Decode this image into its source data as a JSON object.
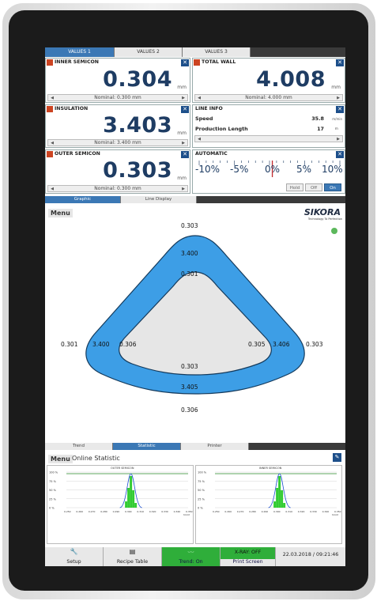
{
  "top_tabs": [
    "VALUES 1",
    "VALUES 2",
    "VALUES 3"
  ],
  "tiles": {
    "inner_semicon": {
      "title": "INNER SEMICON",
      "value": "0.304",
      "unit": "mm",
      "nominal": "Nominal: 0.300 mm"
    },
    "total_wall": {
      "title": "TOTAL WALL",
      "value": "4.008",
      "unit": "mm",
      "nominal": "Nominal: 4.000 mm"
    },
    "insulation": {
      "title": "INSULATION",
      "value": "3.403",
      "unit": "mm",
      "nominal": "Nominal: 3.400 mm"
    },
    "outer_semicon": {
      "title": "OUTER SEMICON",
      "value": "0.303",
      "unit": "mm",
      "nominal": "Nominal: 0.300 mm"
    }
  },
  "line_info": {
    "title": "LINE INFO",
    "speed_label": "Speed",
    "speed_value": "35.8",
    "speed_unit": "m/min",
    "length_label": "Production Length",
    "length_value": "17",
    "length_unit": "m"
  },
  "automatic": {
    "title": "AUTOMATIC",
    "scale": [
      "-10%",
      "-5%",
      "0%",
      "5%",
      "10%"
    ],
    "marker_percent": 0.4,
    "buttons": [
      "Hold",
      "Off",
      "On"
    ]
  },
  "display_tabs": [
    "Graphic",
    "Line Display"
  ],
  "graphic": {
    "menu": "Menu",
    "brand": "SIKORA",
    "brand_tagline": "Technology To Perfection",
    "status_color": "#5cb85c",
    "outer_color": "#3d9ee6",
    "inner_fill": "#e6e6e6",
    "values": {
      "top_outer": "0.303",
      "top_mid": "3.400",
      "top_inner": "0.301",
      "left_outer": "0.301",
      "left_mid": "3.400",
      "left_inner": "0.306",
      "right_inner": "0.305",
      "right_mid": "3.406",
      "right_outer": "0.303",
      "bottom_inner": "0.303",
      "bottom_mid": "3.405",
      "bottom_outer": "0.306"
    }
  },
  "lower_tabs": [
    "Trend",
    "Statistic",
    "Printer"
  ],
  "statistic": {
    "menu": "Menu",
    "title": "Online Statistic",
    "panels": [
      {
        "name": "OUTER SEMICON"
      },
      {
        "name": "INNER SEMICON"
      }
    ],
    "y_ticks": [
      "100 %",
      "75 %",
      "50 %",
      "25 %",
      "0 %"
    ],
    "x_ticks": [
      "0.250",
      "0.260",
      "0.270",
      "0.280",
      "0.290",
      "0.300",
      "0.310",
      "0.320",
      "0.330",
      "0.340",
      "0.350"
    ],
    "x_unit": "[mm]"
  },
  "bottom_bar": {
    "setup": "Setup",
    "recipe": "Recipe Table",
    "trend": "Trend: On",
    "xray": "X-RAY: OFF",
    "print": "Print Screen",
    "datetime": "22.03.2018 / 09:21:46"
  }
}
